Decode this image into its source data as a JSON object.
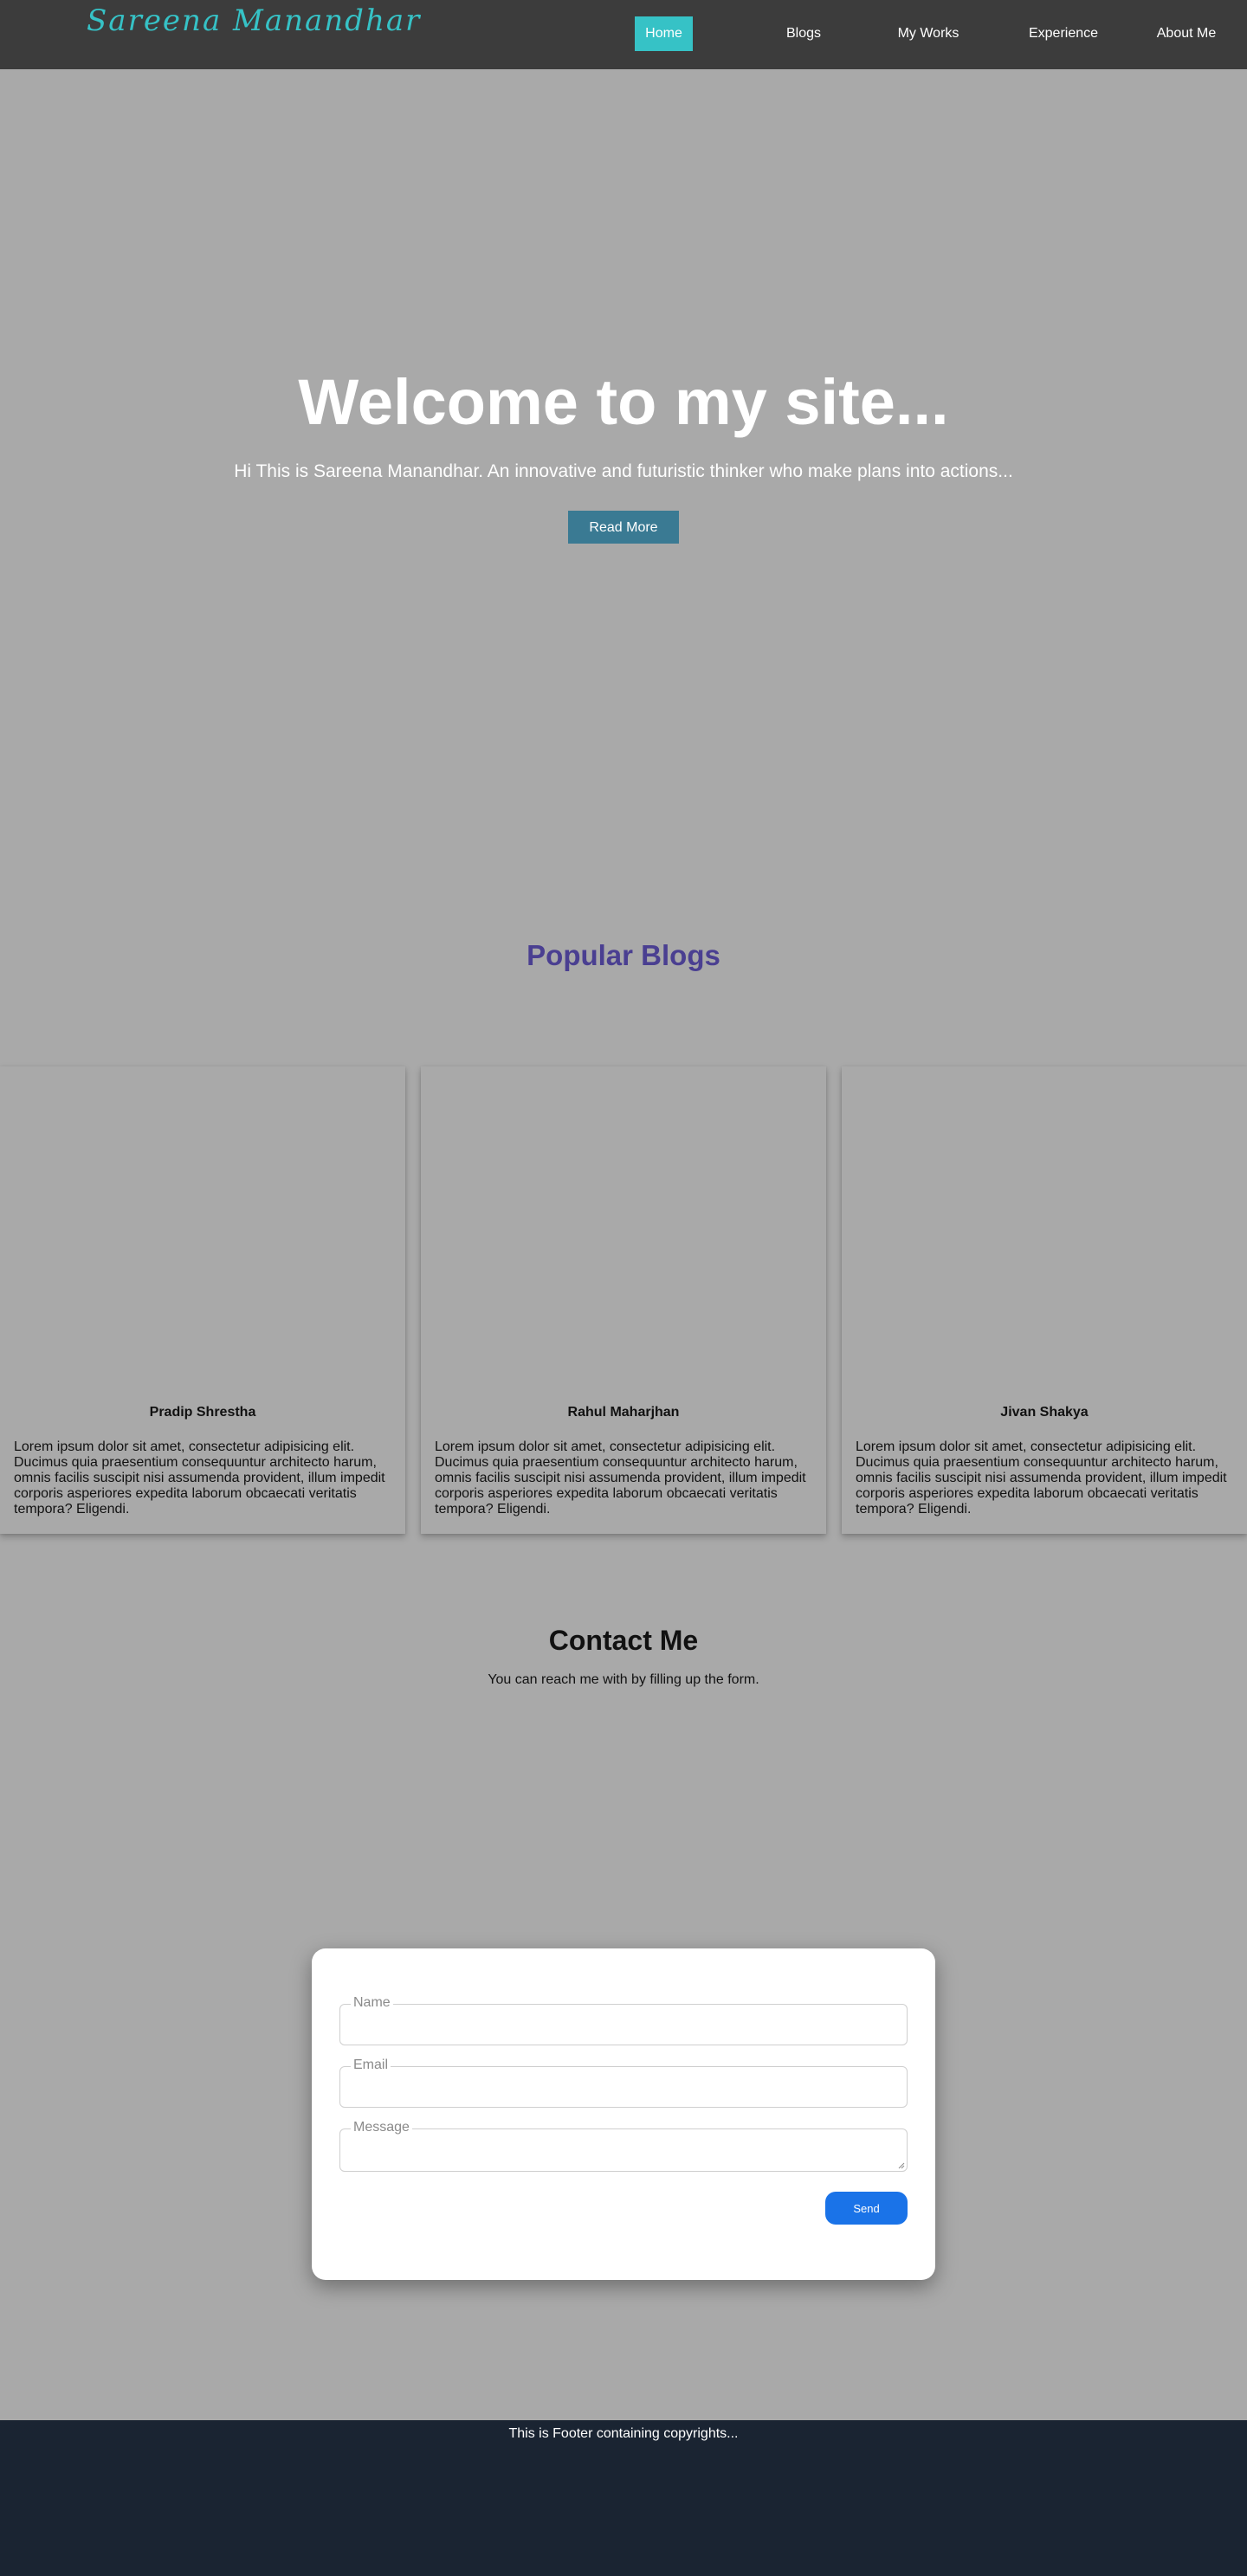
{
  "navbar": {
    "brand": "Sareena Manandhar",
    "links": [
      {
        "label": "Home",
        "active": true
      },
      {
        "label": "Blogs"
      },
      {
        "label": "My Works"
      },
      {
        "label": "Experience"
      },
      {
        "label": "About Me"
      }
    ]
  },
  "hero": {
    "title": "Welcome to my site...",
    "subtitle": "Hi This is Sareena Manandhar. An innovative and futuristic thinker who make plans into actions...",
    "button": "Read More"
  },
  "blogs": {
    "title": "Popular Blogs",
    "cards": [
      {
        "author": "Pradip Shrestha",
        "text": "Lorem ipsum dolor sit amet, consectetur adipisicing elit. Ducimus quia praesentium consequuntur architecto harum, omnis facilis suscipit nisi assumenda provident, illum impedit corporis asperiores expedita laborum obcaecati veritatis tempora? Eligendi."
      },
      {
        "author": "Rahul Maharjhan",
        "text": "Lorem ipsum dolor sit amet, consectetur adipisicing elit. Ducimus quia praesentium consequuntur architecto harum, omnis facilis suscipit nisi assumenda provident, illum impedit corporis asperiores expedita laborum obcaecati veritatis tempora? Eligendi."
      },
      {
        "author": "Jivan Shakya",
        "text": "Lorem ipsum dolor sit amet, consectetur adipisicing elit. Ducimus quia praesentium consequuntur architecto harum, omnis facilis suscipit nisi assumenda provident, illum impedit corporis asperiores expedita laborum obcaecati veritatis tempora? Eligendi."
      }
    ]
  },
  "contact": {
    "title": "Contact Me",
    "subtitle": "You can reach me with by filling up the form.",
    "fields": {
      "name": {
        "label": "Name",
        "value": ""
      },
      "email": {
        "label": "Email",
        "value": ""
      },
      "message": {
        "label": "Message",
        "value": ""
      }
    },
    "send": "Send"
  },
  "footer": {
    "text": "This is Footer containing copyrights..."
  },
  "colors": {
    "page_bg": "#a9a9a9",
    "nav_bg": "#3c3c3c",
    "accent": "#36c2c6",
    "hero_button": "#3a7a93",
    "section_title": "#4a3f91",
    "send_button": "#1a73e8",
    "footer_bg": "#1a2432"
  }
}
